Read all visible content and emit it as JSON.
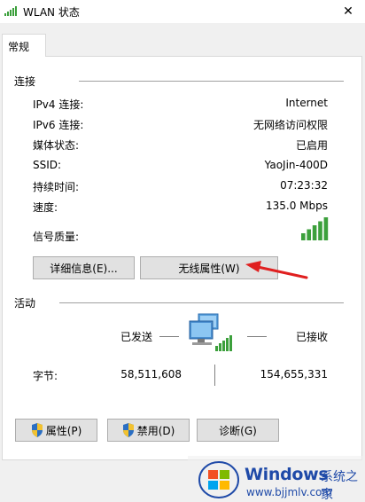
{
  "window": {
    "title": "WLAN 状态",
    "close_glyph": "✕"
  },
  "tabs": [
    {
      "label": "常规"
    }
  ],
  "connection": {
    "group_label": "连接",
    "rows": [
      {
        "label": "IPv4 连接:",
        "value": "Internet"
      },
      {
        "label": "IPv6 连接:",
        "value": "无网络访问权限"
      },
      {
        "label": "媒体状态:",
        "value": "已启用"
      },
      {
        "label": "SSID:",
        "value": "YaoJin-400D"
      },
      {
        "label": "持续时间:",
        "value": "07:23:32"
      },
      {
        "label": "速度:",
        "value": "135.0 Mbps"
      }
    ],
    "signal_label": "信号质量:",
    "signal_bars": 5,
    "signal_max": 5,
    "details_button": "详细信息(E)...",
    "wireless_props_button": "无线属性(W)"
  },
  "activity": {
    "group_label": "活动",
    "sent_label": "已发送",
    "received_label": "已接收",
    "bytes_label": "字节:",
    "bytes_sent": "58,511,608",
    "bytes_received": "154,655,331"
  },
  "buttons": {
    "properties": "属性(P)",
    "disable": "禁用(D)",
    "diagnose": "诊断(G)"
  },
  "watermark": {
    "brand": "Windows",
    "brand_cn": "系统之家",
    "url": "www.bjjmlv.com"
  },
  "colors": {
    "signal_green": "#3ca03c",
    "arrow_red": "#e02020",
    "watermark_blue": "#1f4aa8"
  },
  "icons": {
    "title": "wifi-signal-icon",
    "network": "network-computer-icon",
    "shield": "uac-shield-icon"
  }
}
